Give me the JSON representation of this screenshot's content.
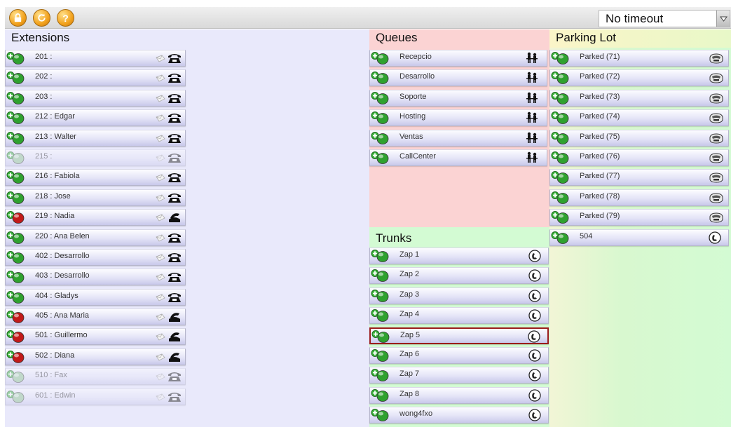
{
  "toolbar": {
    "buttons": [
      "lock-icon",
      "refresh-icon",
      "help-icon"
    ],
    "help_glyph": "?",
    "timeout_value": "No timeout"
  },
  "extensions": {
    "title": "Extensions",
    "items": [
      {
        "label": "201 :",
        "status": "available",
        "phone": "idle"
      },
      {
        "label": "202 :",
        "status": "available",
        "phone": "idle"
      },
      {
        "label": "203 :",
        "status": "available",
        "phone": "idle"
      },
      {
        "label": "212 : Edgar",
        "status": "available",
        "phone": "idle"
      },
      {
        "label": "213 : Walter",
        "status": "available",
        "phone": "idle"
      },
      {
        "label": "215 :",
        "status": "unavailable",
        "phone": "idle"
      },
      {
        "label": "216 : Fabiola",
        "status": "available",
        "phone": "idle"
      },
      {
        "label": "218 : Jose",
        "status": "available",
        "phone": "idle"
      },
      {
        "label": "219 : Nadia",
        "status": "busy",
        "phone": "offhook"
      },
      {
        "label": "220 : Ana Belen",
        "status": "available",
        "phone": "idle"
      },
      {
        "label": "402 : Desarrollo",
        "status": "available",
        "phone": "idle"
      },
      {
        "label": "403 : Desarrollo",
        "status": "available",
        "phone": "idle"
      },
      {
        "label": "404 : Gladys",
        "status": "available",
        "phone": "idle"
      },
      {
        "label": "405 : Ana Maria",
        "status": "busy",
        "phone": "offhook"
      },
      {
        "label": "501 : Guillermo",
        "status": "busy",
        "phone": "offhook"
      },
      {
        "label": "502 : Diana",
        "status": "busy",
        "phone": "offhook"
      },
      {
        "label": "510 : Fax",
        "status": "unavailable",
        "phone": "idle"
      },
      {
        "label": "601 : Edwin",
        "status": "unavailable",
        "phone": "idle"
      }
    ]
  },
  "queues": {
    "title": "Queues",
    "items": [
      {
        "label": "Recepcio"
      },
      {
        "label": "Desarrollo"
      },
      {
        "label": "Soporte"
      },
      {
        "label": "Hosting"
      },
      {
        "label": "Ventas"
      },
      {
        "label": "CallCenter"
      }
    ]
  },
  "trunks": {
    "title": "Trunks",
    "items": [
      {
        "label": "Zap 1"
      },
      {
        "label": "Zap 2"
      },
      {
        "label": "Zap 3"
      },
      {
        "label": "Zap 4"
      },
      {
        "label": "Zap 5",
        "selected": true
      },
      {
        "label": "Zap 6"
      },
      {
        "label": "Zap 7"
      },
      {
        "label": "Zap 8"
      },
      {
        "label": "wong4fxo"
      }
    ]
  },
  "parking": {
    "title": "Parking Lot",
    "items": [
      {
        "label": "Parked (71)",
        "icon": "parked-call-icon"
      },
      {
        "label": "Parked (72)",
        "icon": "parked-call-icon"
      },
      {
        "label": "Parked (73)",
        "icon": "parked-call-icon"
      },
      {
        "label": "Parked (74)",
        "icon": "parked-call-icon"
      },
      {
        "label": "Parked (75)",
        "icon": "parked-call-icon"
      },
      {
        "label": "Parked (76)",
        "icon": "parked-call-icon"
      },
      {
        "label": "Parked (77)",
        "icon": "parked-call-icon"
      },
      {
        "label": "Parked (78)",
        "icon": "parked-call-icon"
      },
      {
        "label": "Parked (79)",
        "icon": "parked-call-icon"
      },
      {
        "label": "504",
        "icon": "trunk-phone-icon"
      }
    ]
  },
  "colors": {
    "available": "#2fa12f",
    "busy": "#c21a1a",
    "plus": "#3bb33b"
  }
}
